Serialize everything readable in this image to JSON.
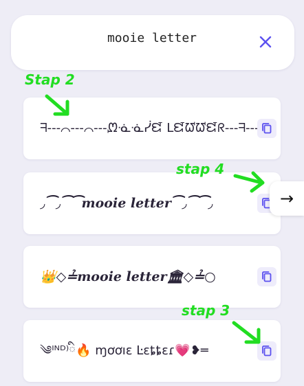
{
  "colors": {
    "page_background": "#eeedf6",
    "card_background": "#ffffff",
    "accent": "#5b50ef",
    "annotation_green": "#22dd22",
    "copy_button_background": "#eeecfb"
  },
  "search": {
    "value": "mooie letter",
    "placeholder": ""
  },
  "icons": {
    "clear": "close-icon",
    "copy": "copy-icon",
    "side_arrow": "arrow-right-icon"
  },
  "results": [
    {
      "text": "ᖷ---⌒---⌒---ᘻᓍᓍᓰᘿ ᒪᘿᘺᘺᘿᖇ---ᖷ---ᖷ---"
    },
    {
      "text": "﻿◞⁀◞⁀⁀𝒎𝒐𝒐𝒊𝒆 𝒍𝒆𝒕𝒕𝒆𝒓⁀◞⁀⁀◞"
    },
    {
      "text": "👑◇≟𝒎𝒐𝒐𝒊𝒆 𝒍𝒆𝒕𝒕𝒆𝒓🏛◇≟○"
    },
    {
      "text": "༄ᴵᴺᴰ⁾ི🔥 ɱơơıɛ Ŀɛȶȶɛɾ💗❥═"
    }
  ],
  "side_arrow": {
    "label": "→"
  },
  "annotations": [
    {
      "label": "Stap 2"
    },
    {
      "label": "stap 4"
    },
    {
      "label": "stap 3"
    }
  ]
}
